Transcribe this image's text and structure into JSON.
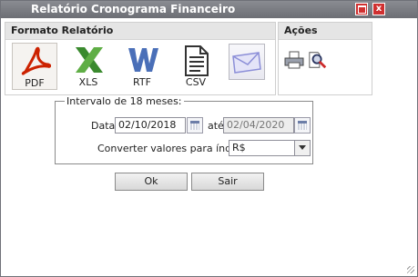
{
  "window": {
    "title": "Relatório Cronograma Financeiro"
  },
  "formato": {
    "heading": "Formato Relatório",
    "items": [
      {
        "label": "PDF",
        "icon": "pdf-icon",
        "color": "#cc2200"
      },
      {
        "label": "XLS",
        "icon": "xls-icon",
        "color": "#3a8a2e"
      },
      {
        "label": "RTF",
        "icon": "rtf-icon",
        "color": "#4a6fb8"
      },
      {
        "label": "CSV",
        "icon": "csv-icon",
        "color": "#333333"
      },
      {
        "label": "",
        "icon": "email-icon",
        "color": "#8c8fd8"
      }
    ]
  },
  "acoes": {
    "heading": "Ações",
    "icons": [
      "printer-icon",
      "preview-icon"
    ]
  },
  "intervalo": {
    "legend": "Intervalo de 18 meses:",
    "data_label": "Data:",
    "data_start": "02/10/2018",
    "ate_label": "até",
    "data_end": "02/04/2020",
    "converter_label": "Converter valores para índice:",
    "converter_value": "R$"
  },
  "buttons": {
    "ok": "Ok",
    "sair": "Sair"
  }
}
